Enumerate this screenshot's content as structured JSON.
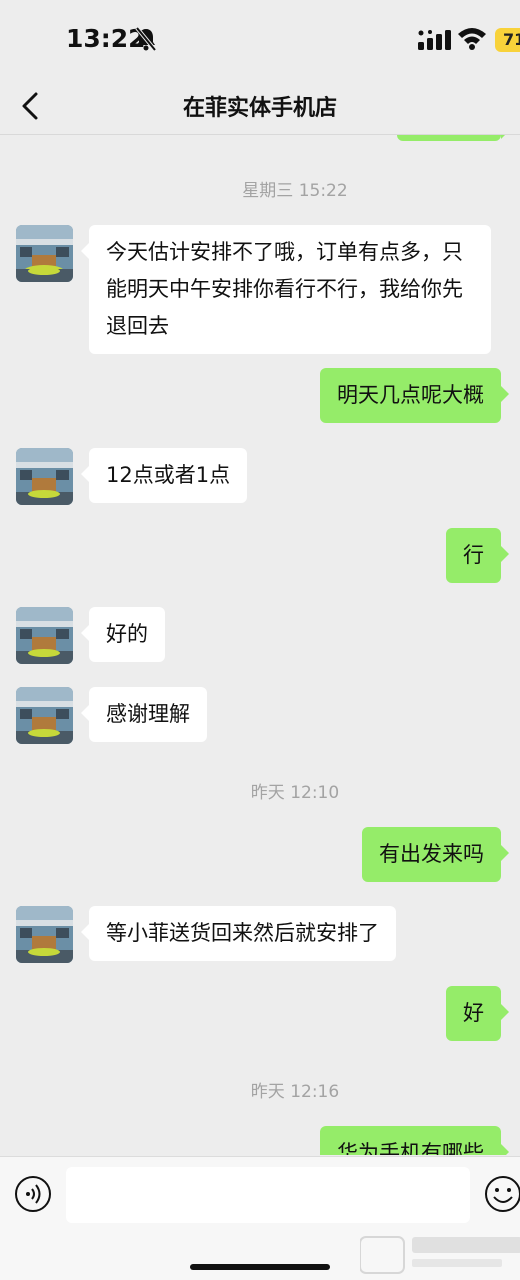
{
  "status_bar": {
    "time": "13:22",
    "battery": "71"
  },
  "header": {
    "title": "在菲实体手机店"
  },
  "messages": {
    "ts1": "星期三 15:22",
    "m1": "今天估计安排不了哦，订单有点多，只能明天中午安排你看行不行，我给你先退回去",
    "m2": "明天几点呢大概",
    "m3": "12点或者1点",
    "m4": "行",
    "m5": "好的",
    "m6": "感谢理解",
    "ts2": "昨天 12:10",
    "m7": "有出发来吗",
    "m8": "等小菲送货回来然后就安排了",
    "m9": "好",
    "ts3": "昨天 12:16",
    "m10": "华为手机有哪些"
  },
  "colors": {
    "background": "#ededed",
    "incoming_bubble": "#ffffff",
    "outgoing_bubble": "#95ec69",
    "timestamp": "#a3a3a3",
    "battery": "#f8d23a"
  },
  "icons": {
    "back": "chevron-left-icon",
    "mute": "bell-slash-icon",
    "voice": "voice-icon",
    "emoji": "emoji-icon"
  }
}
